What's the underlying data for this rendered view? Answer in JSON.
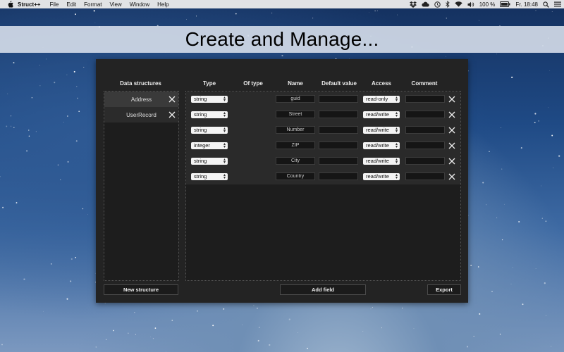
{
  "menubar": {
    "app_name": "Struct++",
    "items": [
      "File",
      "Edit",
      "Format",
      "View",
      "Window",
      "Help"
    ],
    "battery": "100 %",
    "clock": "Fr. 18:48"
  },
  "banner": {
    "title": "Create and Manage..."
  },
  "window": {
    "headers": {
      "structures": "Data structures",
      "type": "Type",
      "of_type": "Of type",
      "name": "Name",
      "default_value": "Default value",
      "access": "Access",
      "comment": "Comment"
    },
    "structures": [
      {
        "label": "Address",
        "selected": true
      },
      {
        "label": "UserRecord",
        "selected": false
      }
    ],
    "fields": [
      {
        "type": "string",
        "name": "guid",
        "default": "",
        "access": "read-only",
        "comment": ""
      },
      {
        "type": "string",
        "name": "Street",
        "default": "",
        "access": "read/write",
        "comment": ""
      },
      {
        "type": "string",
        "name": "Number",
        "default": "",
        "access": "read/write",
        "comment": ""
      },
      {
        "type": "integer",
        "name": "ZIP",
        "default": "",
        "access": "read/write",
        "comment": ""
      },
      {
        "type": "string",
        "name": "City",
        "default": "",
        "access": "read/write",
        "comment": ""
      },
      {
        "type": "string",
        "name": "Country",
        "default": "",
        "access": "read/write",
        "comment": ""
      }
    ],
    "buttons": {
      "new_structure": "New structure",
      "add_field": "Add field",
      "export": "Export"
    }
  }
}
